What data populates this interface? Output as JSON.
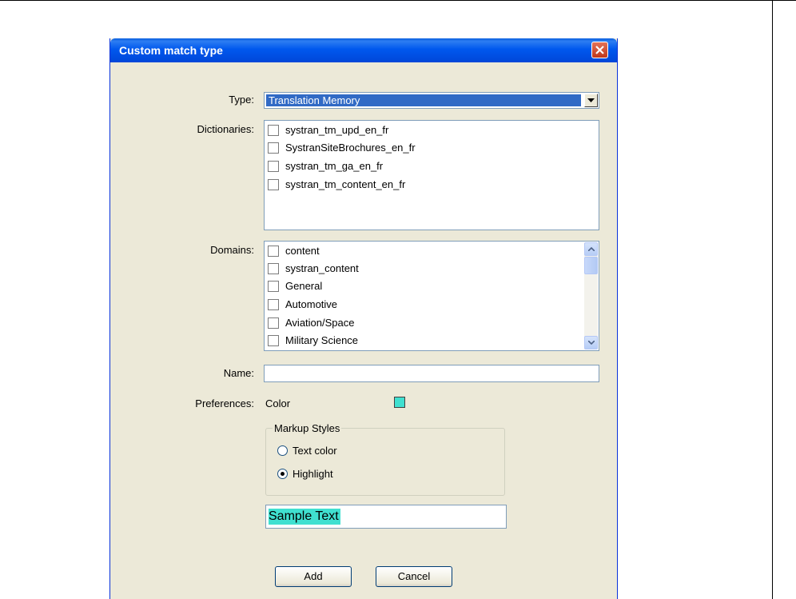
{
  "dialog": {
    "title": "Custom match type",
    "type": {
      "label": "Type:",
      "value": "Translation Memory"
    },
    "dictionaries": {
      "label": "Dictionaries:",
      "items": [
        "systran_tm_upd_en_fr",
        "SystranSiteBrochures_en_fr",
        "systran_tm_ga_en_fr",
        "systran_tm_content_en_fr"
      ]
    },
    "domains": {
      "label": "Domains:",
      "items": [
        "content",
        "systran_content",
        "General",
        "Automotive",
        "Aviation/Space",
        "Military Science"
      ]
    },
    "name": {
      "label": "Name:",
      "value": ""
    },
    "preferences": {
      "label": "Preferences:",
      "color_label": "Color",
      "color_value": "#40e0d0",
      "markup_styles": {
        "legend": "Markup Styles",
        "options": [
          {
            "label": "Text color",
            "selected": false
          },
          {
            "label": "Highlight",
            "selected": true
          }
        ]
      },
      "sample_text": "Sample Text"
    },
    "buttons": {
      "add": "Add",
      "cancel": "Cancel"
    }
  }
}
